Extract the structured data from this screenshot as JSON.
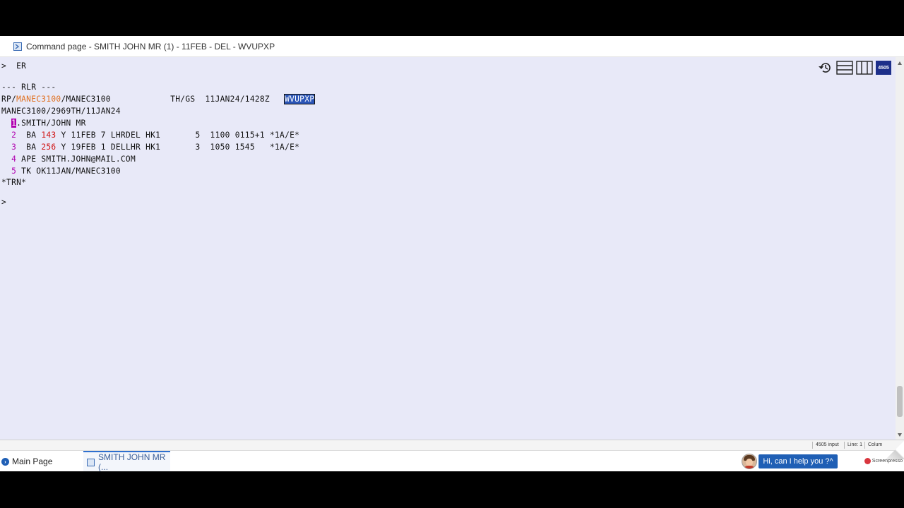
{
  "window": {
    "title": "Command page - SMITH JOHN MR (1) - 11FEB - DEL - WVUPXP"
  },
  "terminal": {
    "command_line": {
      "prompt": ">",
      "command": "ER"
    },
    "header_rlr": "--- RLR ---",
    "rp_line": {
      "prefix": "RP/",
      "office_highlight": "MANEC3100",
      "office_rest": "/MANEC3100",
      "agent": "TH/GS",
      "timestamp": "11JAN24/1428Z",
      "record_locator": "WVUPXP"
    },
    "creation_line": "MANEC3100/2969TH/11JAN24",
    "passenger": {
      "number": "1",
      "name": ".SMITH/JOHN MR"
    },
    "segments": [
      {
        "num": "2",
        "airline": "BA",
        "flight": "143",
        "rest": "Y 11FEB 7 LHRDEL HK1",
        "tail": "5  1100 0115+1 *1A/E*"
      },
      {
        "num": "3",
        "airline": "BA",
        "flight": "256",
        "rest": "Y 19FEB 1 DELLHR HK1",
        "tail": "3  1050 1545   *1A/E*"
      }
    ],
    "elements": [
      {
        "num": "4",
        "text": "APE SMITH.JOHN@MAIL.COM"
      },
      {
        "num": "5",
        "text": "TK OK11JAN/MANEC3100"
      }
    ],
    "footer": "*TRN*",
    "next_prompt": ">"
  },
  "toolbar": {
    "history_icon": "history-icon",
    "horizontal_split_icon": "horizontal-split-icon",
    "vertical_split_icon": "vertical-split-icon",
    "badge_label": "4505"
  },
  "statusbar": {
    "input_label": "4505 input",
    "line_label": "Line: 1",
    "column_label": "Colum"
  },
  "tabs": [
    {
      "label": "Main Page"
    },
    {
      "label": "SMITH JOHN MR (..."
    }
  ],
  "help": {
    "label": "Hi, can I help you ?",
    "chevron": "^",
    "watermark": "Screenpresso"
  }
}
